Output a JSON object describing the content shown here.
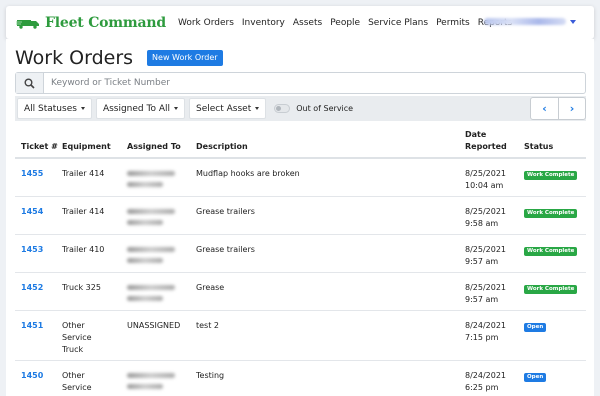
{
  "navbar": {
    "brand": "Fleet Command",
    "links": [
      "Work Orders",
      "Inventory",
      "Assets",
      "People",
      "Service Plans",
      "Permits",
      "Reports"
    ]
  },
  "page": {
    "title": "Work Orders",
    "new_button": "New Work Order"
  },
  "search": {
    "placeholder": "Keyword or Ticket Number"
  },
  "filters": {
    "status": "All Statuses",
    "assigned": "Assigned To All",
    "asset": "Select Asset",
    "out_of_service": "Out of Service"
  },
  "pager": {
    "prev": "‹",
    "next": "›"
  },
  "table": {
    "headers": [
      "Ticket #",
      "Equipment",
      "Assigned To",
      "Description",
      "Date Reported",
      "Status"
    ],
    "rows": [
      {
        "ticket": "1455",
        "equipment": "Trailer 414",
        "assigned": "",
        "description": "Mudflap hooks are broken",
        "date": "8/25/2021",
        "time": "10:04 am",
        "status": "Work Complete",
        "status_color": "#29a745"
      },
      {
        "ticket": "1454",
        "equipment": "Trailer 414",
        "assigned": "",
        "description": "Grease trailers",
        "date": "8/25/2021",
        "time": "9:58 am",
        "status": "Work Complete",
        "status_color": "#29a745"
      },
      {
        "ticket": "1453",
        "equipment": "Trailer 410",
        "assigned": "",
        "description": "Grease trailers",
        "date": "8/25/2021",
        "time": "9:57 am",
        "status": "Work Complete",
        "status_color": "#29a745"
      },
      {
        "ticket": "1452",
        "equipment": "Truck 325",
        "assigned": "",
        "description": "Grease",
        "date": "8/25/2021",
        "time": "9:57 am",
        "status": "Work Complete",
        "status_color": "#29a745"
      },
      {
        "ticket": "1451",
        "equipment": "Other Service Truck",
        "assigned": "UNASSIGNED",
        "description": "test 2",
        "date": "8/24/2021",
        "time": "7:15 pm",
        "status": "Open",
        "status_color": "#1e7be3"
      },
      {
        "ticket": "1450",
        "equipment": "Other Service",
        "assigned": "",
        "description": "Testing",
        "date": "8/24/2021",
        "time": "6:25 pm",
        "status": "Open",
        "status_color": "#1e7be3"
      }
    ]
  },
  "colors": {
    "brand": "#2e9b3e",
    "primary": "#1e7be3",
    "complete": "#29a745"
  }
}
